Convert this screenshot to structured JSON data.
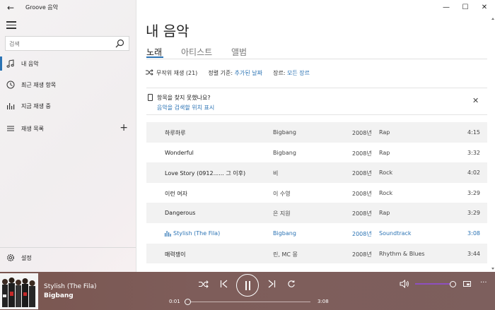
{
  "window": {
    "app_title": "Groove 음악",
    "back_glyph": "←",
    "minimize_glyph": "—",
    "maximize_glyph": "☐",
    "close_glyph": "✕"
  },
  "sidebar": {
    "search_placeholder": "검색",
    "items": [
      {
        "label": "내 음악",
        "icon": "music-note-icon",
        "active": true
      },
      {
        "label": "최근 재생 항목",
        "icon": "clock-icon",
        "active": false
      },
      {
        "label": "지금 재생 중",
        "icon": "bars-icon",
        "active": false
      },
      {
        "label": "재생 목록",
        "icon": "playlist-icon",
        "active": false
      }
    ],
    "add_glyph": "+",
    "settings_label": "설정"
  },
  "main": {
    "title": "내 음악",
    "tabs": [
      "노래",
      "아티스트",
      "앨범"
    ],
    "selected_tab": 0,
    "toolbar": {
      "shuffle_label": "무작위 재생 (21)",
      "sort_prefix": "정렬 기준:",
      "sort_value": "추가된 날짜",
      "genre_prefix": "장르:",
      "genre_value": "모든 장르"
    },
    "hint": {
      "question": "항목을 찾지 못했나요?",
      "link": "음악을 검색할 위치 표시",
      "close_glyph": "✕"
    },
    "songs": [
      {
        "title": "하루하루",
        "artist": "Bigbang",
        "year": "2008년",
        "genre": "Rap",
        "duration": "4:15"
      },
      {
        "title": "Wonderful",
        "artist": "Bigbang",
        "year": "2008년",
        "genre": "Rap",
        "duration": "3:32"
      },
      {
        "title": "Love Story (0912...... 그 이후)",
        "artist": "비",
        "year": "2008년",
        "genre": "Rock",
        "duration": "4:02"
      },
      {
        "title": "이런 여자",
        "artist": "이 수영",
        "year": "2008년",
        "genre": "Rock",
        "duration": "3:29"
      },
      {
        "title": "Dangerous",
        "artist": "은 지원",
        "year": "2008년",
        "genre": "Rap",
        "duration": "3:29"
      },
      {
        "title": "Stylish (The Fila)",
        "artist": "Bigbang",
        "year": "2008년",
        "genre": "Soundtrack",
        "duration": "3:08",
        "playing": true
      },
      {
        "title": "매력쟁이",
        "artist": "린, MC 몽",
        "year": "2008년",
        "genre": "Rhythm & Blues",
        "duration": "3:44"
      }
    ]
  },
  "player": {
    "track_title": "Stylish (The Fila)",
    "artist": "Bigbang",
    "elapsed": "0:01",
    "total": "3:08",
    "progress_fraction": 0.005,
    "volume_fraction": 1.0,
    "more_glyph": "···",
    "accent_color": "#8e4fbf"
  },
  "colors": {
    "accent": "#2b73b4",
    "player_bg": "#7c5c59"
  }
}
